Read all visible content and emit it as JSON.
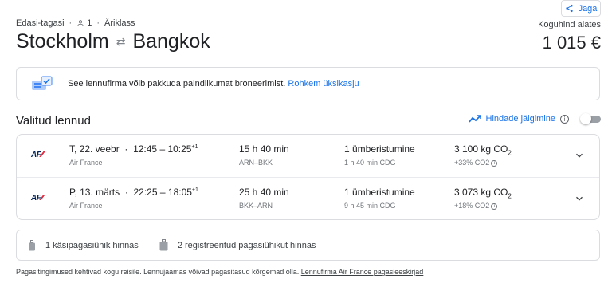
{
  "header": {
    "trip_type": "Edasi-tagasi",
    "passengers": "1",
    "cabin_class": "Äriklass",
    "origin": "Stockholm",
    "destination": "Bangkok",
    "share_label": "Jaga",
    "total_label": "Koguhind alates",
    "total_price": "1 015 €"
  },
  "notice": {
    "text": "See lennufirma võib pakkuda paindlikumat broneerimist.",
    "link": "Rohkem üksikasju"
  },
  "selected": {
    "title": "Valitud lennud",
    "track_label": "Hindade jälgimine",
    "tracking_enabled": false
  },
  "flights": [
    {
      "date": "T, 22. veebr",
      "depart": "12:45",
      "arrive": "10:25",
      "day_offset": "+1",
      "airline": "Air France",
      "duration": "15 h 40 min",
      "route": "ARN–BKK",
      "stops": "1 ümberistumine",
      "layover": "1 h 40 min CDG",
      "emissions_value": "3 100 kg CO",
      "emissions_sub": "2",
      "emissions_delta": "+33% CO2"
    },
    {
      "date": "P, 13. märts",
      "depart": "22:25",
      "arrive": "18:05",
      "day_offset": "+1",
      "airline": "Air France",
      "duration": "25 h 40 min",
      "route": "BKK–ARN",
      "stops": "1 ümberistumine",
      "layover": "9 h 45 min CDG",
      "emissions_value": "3 073 kg CO",
      "emissions_sub": "2",
      "emissions_delta": "+18% CO2"
    }
  ],
  "baggage": {
    "carry_on": "1 käsipagasiühik hinnas",
    "checked": "2 registreeritud pagasiühikut hinnas"
  },
  "footer": {
    "text": "Pagasitingimused kehtivad kogu reisile. Lennujaamas võivad pagasitasud kõrgemad olla.",
    "link": "Lennufirma Air France pagasieeskirjad"
  },
  "colors": {
    "accent": "#1a73e8",
    "border": "#dadce0",
    "text_secondary": "#70757a"
  },
  "icons": {
    "share": "share-icon",
    "person": "person-icon",
    "swap": "swap-arrows-icon",
    "notice": "booking-options-icon",
    "trend": "price-trend-icon",
    "info": "info-icon",
    "chevron": "chevron-down-icon",
    "carry_on": "carry-on-bag-icon",
    "checked_bag": "checked-bag-icon"
  }
}
